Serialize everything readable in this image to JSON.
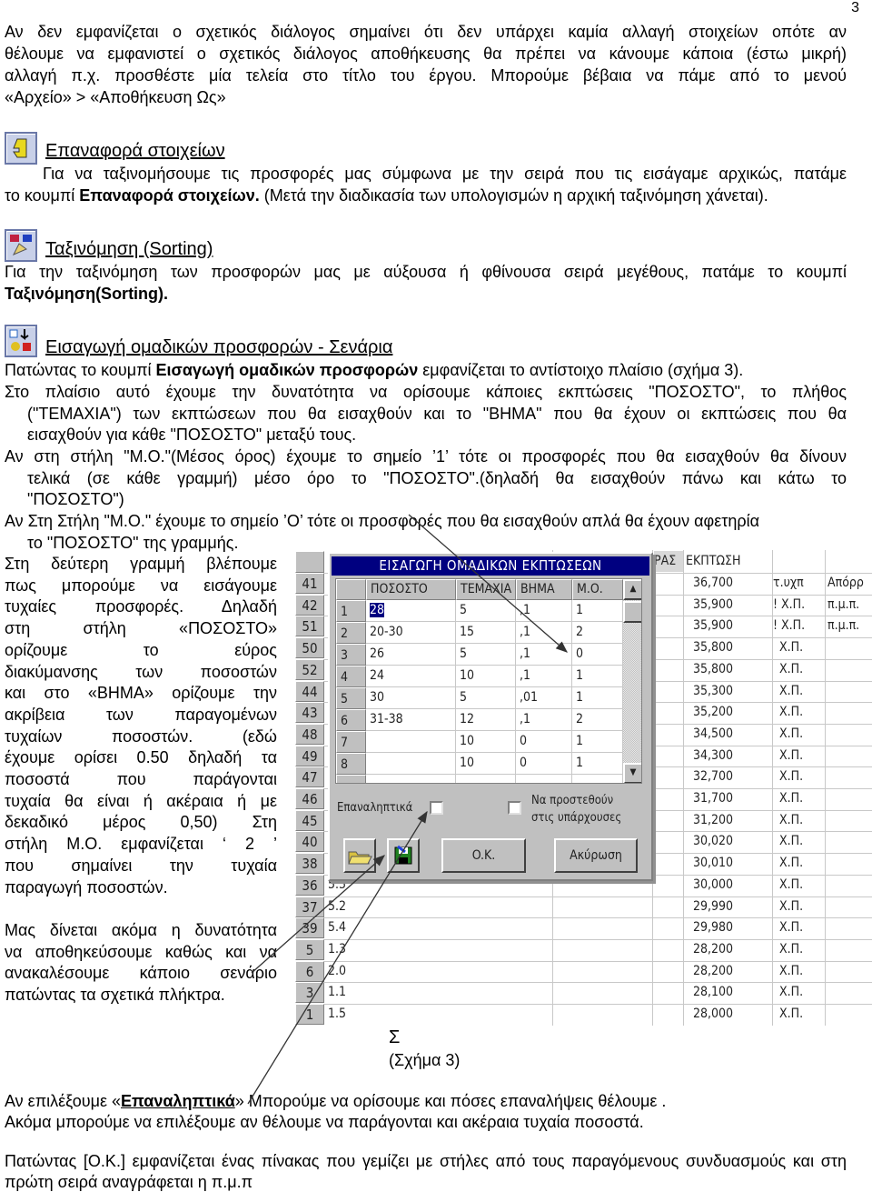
{
  "page_number": "3",
  "intro": [
    "Αν δεν εμφανίζεται ο σχετικός διάλογος σημαίνει ότι δεν υπάρχει καμία αλλαγή στοιχείων οπότε αν",
    "θέλουμε να εμφανιστεί ο σχετικός διάλογος αποθήκευσης θα πρέπει να κάνουμε κάποια (έστω μικρή)",
    "αλλαγή π.χ. προσθέστε μία τελεία στο τίτλο του έργου. Μπορούμε βέβαια να πάμε από το μενού",
    "«Αρχείο» > «Αποθήκευση Ως»"
  ],
  "section_restore": {
    "heading": "Επαναφορά στοιχείων",
    "line1": "Για να ταξινομήσουμε τις προσφορές μας σύμφωνα με την σειρά που τις εισάγαμε αρχικώς, πατάμε",
    "line2_pre": "το κουμπί ",
    "line2_bold": "Επαναφορά στοιχείων.",
    "line2_post": " (Μετά την διαδικασία των υπολογισμών η αρχική ταξινόμηση χάνεται)."
  },
  "section_sort": {
    "heading": "Ταξινόμηση (Sorting)",
    "line1": "Για την ταξινόμηση των προσφορών μας με αύξουσα ή φθίνουσα σειρά μεγέθους, πατάμε το κουμπί",
    "line2_bold": "Ταξινόμηση(Sorting)."
  },
  "section_import": {
    "heading": "Εισαγωγή ομαδικών προσφορών - Σενάρια",
    "l1_pre": "Πατώντας το κουμπί ",
    "l1_bold": "Εισαγωγή ομαδικών προσφορών",
    "l1_post": " εμφανίζεται το αντίστοιχο πλαίσιο (σχήμα 3).",
    "lines": [
      "Στο πλαίσιο αυτό έχουμε την δυνατότητα να ορίσουμε κάποιες εκπτώσεις \"ΠΟΣΟΣΤΟ\", το πλήθος",
      "(\"ΤΕΜΑΧΙΑ\") των εκπτώσεων που θα εισαχθούν και το \"ΒΗΜΑ\" που θα έχουν οι εκπτώσεις που θα",
      "εισαχθούν για κάθε \"ΠΟΣΟΣΤΟ\" μεταξύ τους.",
      "Αν στη στήλη \"Μ.Ο.\"(Μέσος όρος) έχουμε το σημείο ’1’ τότε οι προσφορές που θα εισαχθούν θα δίνουν",
      "τελικά (σε κάθε γραμμή) μέσο όρο το \"ΠΟΣΟΣΤΟ\".(δηλαδή θα εισαχθούν πάνω και κάτω το",
      "\"ΠΟΣΟΣΤΟ\")",
      "Αν Στη Στήλη \"Μ.Ο.\" έχουμε το σημείο ’Ο’ τότε οι προσφορές που θα εισαχθούν απλά θα έχουν αφετηρία",
      "το \"ΠΟΣΟΣΤΟ\" της γραμμής."
    ]
  },
  "side_text": [
    "Στη δεύτερη γραμμή βλέπουμε",
    "πως μπορούμε να εισάγουμε",
    "τυχαίες προσφορές. Δηλαδή",
    "στη στήλη «ΠΟΣΟΣΤΟ»",
    "ορίζουμε το εύρος",
    "διακύμανσης των ποσοστών",
    "και στο «ΒΗΜΑ» ορίζουμε την",
    "ακρίβεια των παραγομένων",
    "τυχαίων ποσοστών. (εδώ",
    "έχουμε ορίσει 0.50 δηλαδή τα",
    "ποσοστά που παράγονται",
    "τυχαία θα είναι ή ακέραια ή με",
    "δεκαδικό μέρος 0,50) Στη",
    "στήλη Μ.Ο. εμφανίζεται ‘ 2 ’",
    "που σημαίνει την τυχαία",
    "παραγωγή ποσοστών."
  ],
  "side_text2": [
    "Μας δίνεται ακόμα η δυνατότητα",
    "να αποθηκεύσουμε καθώς και να",
    "ανακαλέσουμε κάποιο σενάριο",
    "πατώντας τα σχετικά πλήκτρα."
  ],
  "figure": {
    "background_grid": {
      "row_numbers": [
        "41",
        "42",
        "51",
        "50",
        "52",
        "44",
        "43",
        "48",
        "49",
        "47",
        "46",
        "45",
        "40",
        "38",
        "36",
        "37",
        "39",
        "5",
        "6",
        "3",
        "1"
      ],
      "values_below_dialog": [
        "5.5",
        "5.2",
        "5.4",
        "1.3",
        "2.0",
        "1.1",
        "1.5"
      ],
      "headers": [
        "ΡΑΣ",
        "ΕΚΠΤΩΣΗ"
      ],
      "discounts": [
        "36,700",
        "35,900",
        "35,900",
        "35,800",
        "35,800",
        "35,300",
        "35,200",
        "34,500",
        "34,300",
        "32,700",
        "31,700",
        "31,200",
        "30,020",
        "30,010",
        "30,000",
        "29,990",
        "29,980",
        "28,200",
        "28,200",
        "28,100",
        "28,000"
      ],
      "codes": [
        "τ.υχπ",
        "! Χ.Π.",
        "! Χ.Π.",
        "Χ.Π.",
        "Χ.Π.",
        "Χ.Π.",
        "Χ.Π.",
        "Χ.Π.",
        "Χ.Π.",
        "Χ.Π.",
        "Χ.Π.",
        "Χ.Π.",
        "Χ.Π.",
        "Χ.Π.",
        "Χ.Π.",
        "Χ.Π.",
        "Χ.Π.",
        "Χ.Π.",
        "Χ.Π.",
        "Χ.Π.",
        "Χ.Π."
      ],
      "notes": [
        "Απόρρ",
        "π.μ.π.",
        "π.μ.π."
      ]
    },
    "dialog": {
      "title": "ΕΙΣΑΓΩΓΗ ΟΜΑΔΙΚΩΝ ΕΚΠΤΩΣΕΩΝ",
      "columns": [
        "ΠΟΣΟΣΤΟ",
        "ΤΕΜΑΧΙΑ",
        "ΒΗΜΑ",
        "Μ.Ο."
      ],
      "rows": [
        [
          "1",
          "28",
          "5",
          ",1",
          "1"
        ],
        [
          "2",
          "20-30",
          "15",
          ",1",
          "2"
        ],
        [
          "3",
          "26",
          "5",
          ",1",
          "0"
        ],
        [
          "4",
          "24",
          "10",
          ",1",
          "1"
        ],
        [
          "5",
          "30",
          "5",
          ",01",
          "1"
        ],
        [
          "6",
          "31-38",
          "12",
          ",1",
          "2"
        ],
        [
          "7",
          "",
          "10",
          "0",
          "1"
        ],
        [
          "8",
          "",
          "10",
          "0",
          "1"
        ]
      ],
      "repeat_label": "Επαναληπτικά",
      "repeat_checked": false,
      "append_label_1": "Να προστεθούν",
      "append_label_2": "στις υπάρχουσες",
      "append_checked": false,
      "ok_label": "O.K.",
      "cancel_label": "Ακύρωση"
    },
    "sigma": "Σ",
    "caption": "(Σχήμα 3)"
  },
  "after": {
    "l1_pre": "Αν επιλέξουμε «",
    "l1_bold": "Επαναληπτικά",
    "l1_post": "» Μπορούμε να ορίσουμε και πόσες επαναλήψεις θέλουμε .",
    "l2": "Ακόμα μπορούμε να επιλέξουμε αν θέλουμε να παράγονται και ακέραια τυχαία ποσοστά.",
    "l3": "Πατώντας [Ο.Κ.] εμφανίζεται ένας πίνακας που γεμίζει με στήλες από τους παραγόμενους συνδυασμούς και στη",
    "l4": "πρώτη σειρά αναγράφεται η π.μ.π"
  },
  "colors": {
    "title_bar": "#000080",
    "dialog_bg": "#c0c0c0",
    "selection": "#000080"
  }
}
